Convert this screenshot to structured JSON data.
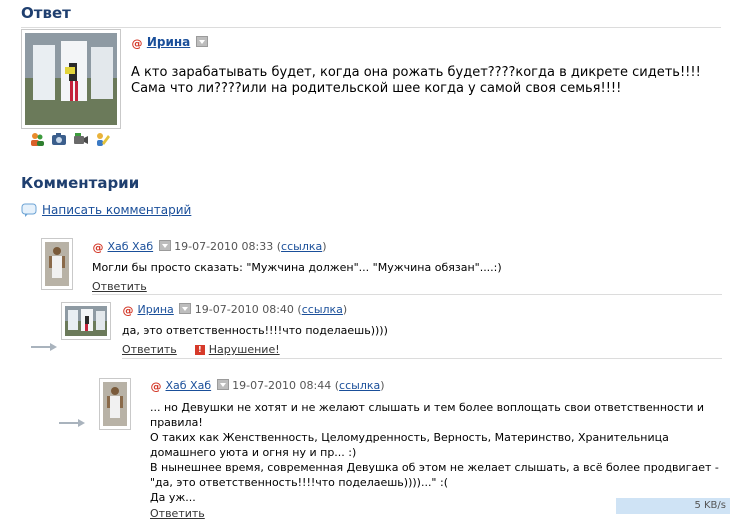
{
  "answer": {
    "title": "Ответ",
    "author": "Ирина",
    "text": "А кто зарабатывать будет, когда она рожать будет????когда в дикрете сидеть!!!!Сама что ли????или на родительской шее когда у самой своя семья!!!!"
  },
  "comments_section": {
    "title": "Комментарии",
    "write_link": "Написать комментарий"
  },
  "comments": [
    {
      "author": "Хаб Хаб",
      "date": "19-07-2010 08:33",
      "link": "ссылка",
      "text": "Могли бы просто сказать: \"Мужчина должен\"... \"Мужчина обязан\"....:)",
      "reply": "Ответить"
    },
    {
      "author": "Ирина",
      "date": "19-07-2010 08:40",
      "link": "ссылка",
      "text": "да, это ответственность!!!!что поделаешь))))",
      "reply": "Ответить",
      "report": "Нарушение!"
    },
    {
      "author": "Хаб Хаб",
      "date": "19-07-2010 08:44",
      "link": "ссылка",
      "lines": [
        "... но Девушки не хотят и не желают слышать и тем более воплощать свои ответственности и",
        "правила!",
        "О таких как Женственность, Целомудренность, Верность, Материнство, Хранительница",
        "домашнего уюта и огня ну и пр... :)",
        "В нынешнее время, современная Девушка об этом не желает слышать, а всё более продвигает -",
        "\"да, это ответственность!!!!что поделаешь))))...\" :(",
        "Да уж..."
      ],
      "reply": "Ответить"
    }
  ],
  "status_bar": {
    "speed": "5 KB/s"
  },
  "icons": [
    "at-icon",
    "dropdown-icon",
    "users-icon",
    "camera-icon",
    "video-icon",
    "edit-icon",
    "comment-icon",
    "reply-arrow-icon",
    "warning-icon"
  ],
  "colors": {
    "link": "#1a4f9a",
    "heading": "#1f3f6f",
    "at": "#d43a2a"
  }
}
